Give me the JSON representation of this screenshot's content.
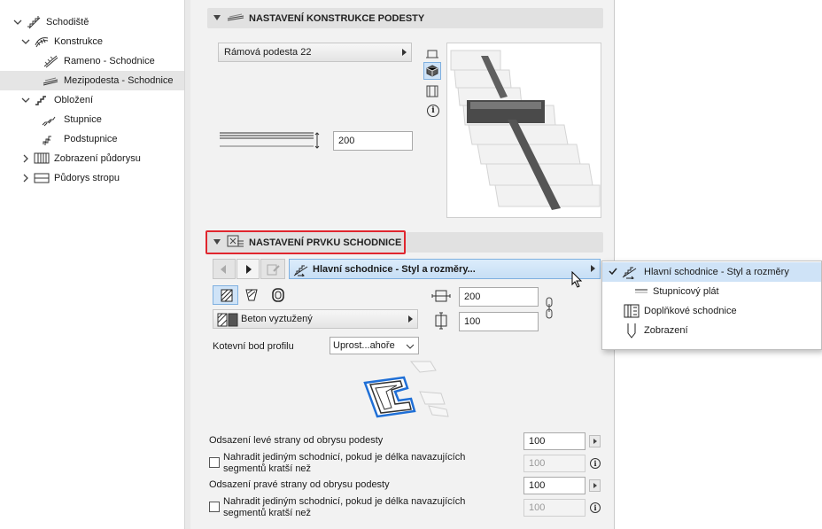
{
  "tree": {
    "items": [
      {
        "label": "Schodiště",
        "expanded": true
      },
      {
        "label": "Konstrukce",
        "expanded": true
      },
      {
        "label": "Rameno - Schodnice"
      },
      {
        "label": "Mezipodesta - Schodnice",
        "selected": true
      },
      {
        "label": "Obložení",
        "expanded": true
      },
      {
        "label": "Stupnice"
      },
      {
        "label": "Podstupnice"
      },
      {
        "label": "Zobrazení půdorysu",
        "expanded": false
      },
      {
        "label": "Půdorys stropu",
        "expanded": false
      }
    ]
  },
  "section1": {
    "title": "NASTAVENÍ KONSTRUKCE PODESTY",
    "type_dropdown": "Rámová podesta 22",
    "thickness_value": "200"
  },
  "section2": {
    "title": "NASTAVENÍ PRVKU SCHODNICE",
    "element_dropdown": "Hlavní schodnice - Styl a rozměry...",
    "material_dropdown": "Beton vyztužený",
    "width_value": "200",
    "height_value": "100",
    "anchor_label": "Kotevní bod profilu",
    "anchor_value": "Uprost...ahoře",
    "left_offset_label": "Odsazení levé strany od obrysu podesty",
    "left_offset_value": "100",
    "left_replace_label_1": "Nahradit jediným schodnicí, pokud je délka navazujících",
    "left_replace_label_2": "segmentů kratší než",
    "left_replace_value": "100",
    "right_offset_label": "Odsazení pravé strany od obrysu podesty",
    "right_offset_value": "100",
    "right_replace_label_1": "Nahradit jediným schodnicí, pokud je délka navazujících",
    "right_replace_label_2": "segmentů kratší než",
    "right_replace_value": "100"
  },
  "popup": {
    "items": [
      {
        "label": "Hlavní schodnice - Styl a rozměry",
        "checked": true,
        "icon": "main-stringer-icon"
      },
      {
        "label": "Stupnicový plát",
        "icon": "tread-plate-icon"
      },
      {
        "label": "Doplňkové schodnice",
        "icon": "additional-stringer-icon"
      },
      {
        "label": "Zobrazení",
        "icon": "display-pen-icon"
      }
    ]
  },
  "colors": {
    "highlight_border": "#e0262e",
    "accent_blue": "#2f7ed8",
    "selected_row": "#e5e5e5",
    "popup_highlight": "#cfe3f7"
  }
}
